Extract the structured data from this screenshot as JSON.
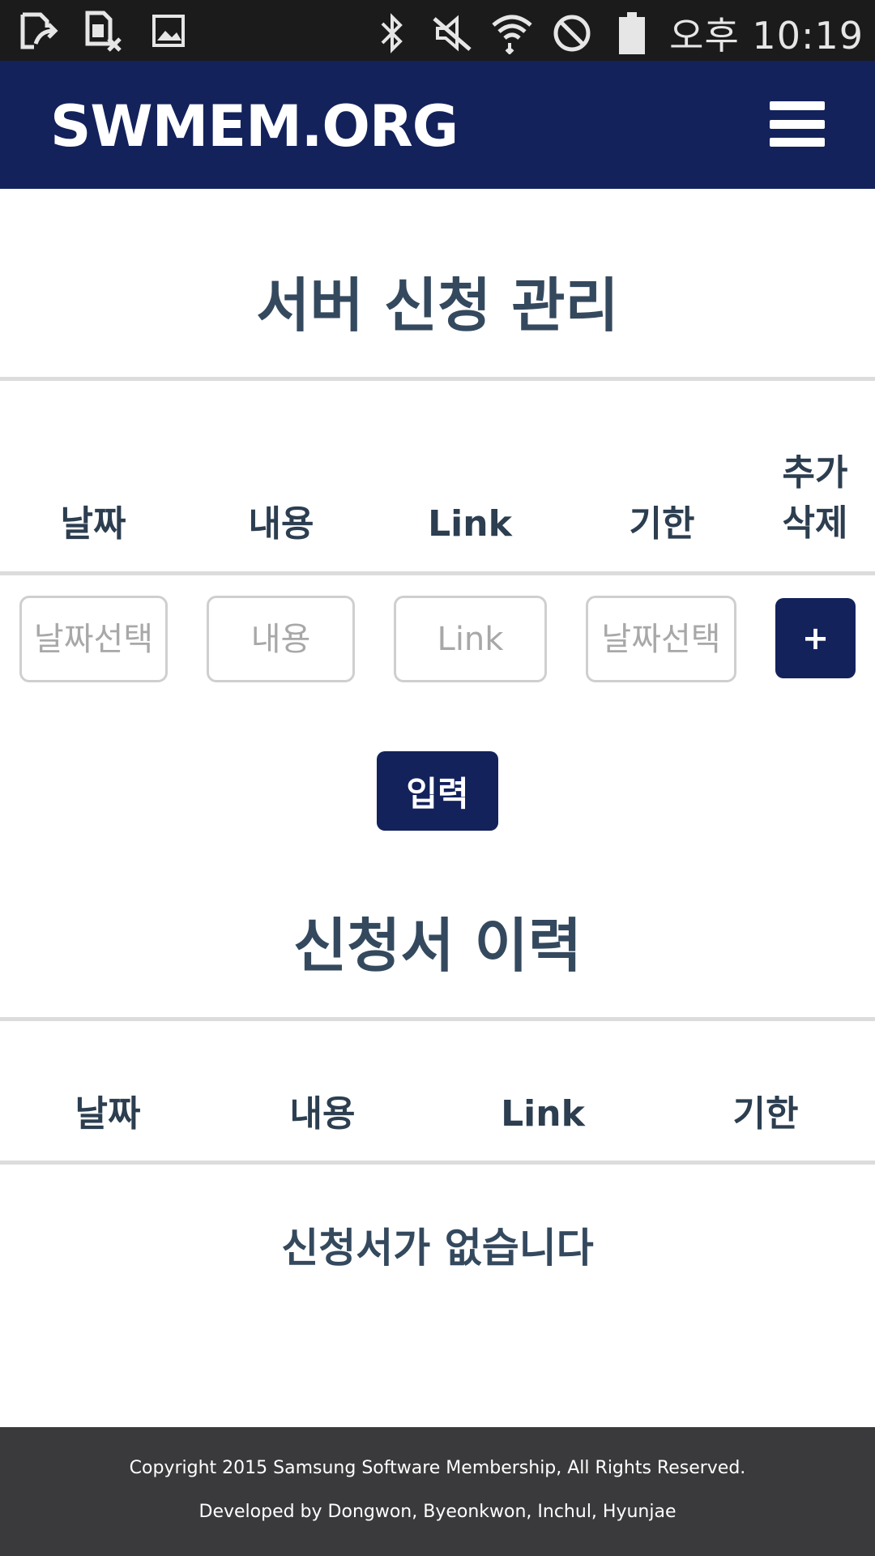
{
  "status_bar": {
    "time": "오후 10:19",
    "left_icons": [
      "file-upload-icon",
      "sim-card-off-icon",
      "image-icon"
    ],
    "right_icons": [
      "bluetooth-icon",
      "mute-icon",
      "wifi-icon",
      "block-icon",
      "battery-icon"
    ]
  },
  "navbar": {
    "brand": "SWMEM.ORG",
    "menu_icon": "hamburger-menu-icon"
  },
  "request_section": {
    "title": "서버 신청 관리",
    "headers": {
      "date": "날짜",
      "content": "내용",
      "link": "Link",
      "deadline": "기한",
      "add_delete": "추가\n삭제"
    },
    "inputs": {
      "date_placeholder": "날짜선택",
      "content_placeholder": "내용",
      "link_placeholder": "Link",
      "deadline_placeholder": "날짜선택"
    },
    "add_button": "+",
    "submit_button": "입력"
  },
  "history_section": {
    "title": "신청서 이력",
    "headers": {
      "date": "날짜",
      "content": "내용",
      "link": "Link",
      "deadline": "기한"
    },
    "empty_message": "신청서가 없습니다"
  },
  "footer": {
    "copyright": "Copyright 2015 Samsung Software Membership, All Rights Reserved.",
    "developers": "Developed by Dongwon, Byeonkwon, Inchul, Hyunjae"
  },
  "colors": {
    "brand": "#13225b",
    "heading": "#34495e",
    "footer": "#3a3a3c"
  }
}
